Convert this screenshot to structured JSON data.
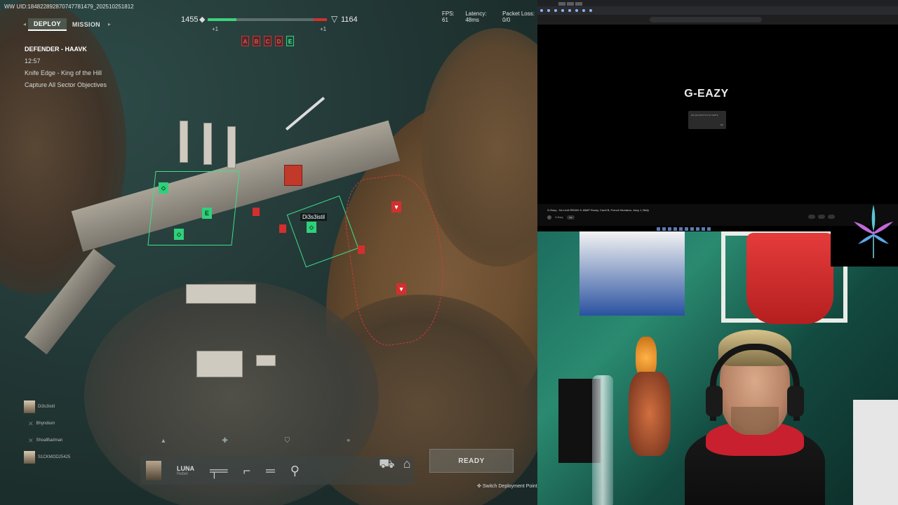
{
  "game": {
    "uid": "WW UID:184822892870747781479_202510251812",
    "tabs": [
      {
        "label": "DEPLOY",
        "active": true
      },
      {
        "label": "MISSION",
        "active": false
      }
    ],
    "mission": {
      "role": "DEFENDER - HAAVK",
      "timer": "12:57",
      "map_mode": "Knife Edge - King of the Hill",
      "objective": "Capture All Sector Objectives"
    },
    "score": {
      "friendly": "1455",
      "enemy": "1164",
      "friendly_plus": "+1",
      "enemy_plus": "+1",
      "friendly_progress": 0.24,
      "enemy_progress": 0.11
    },
    "objectives": [
      {
        "letter": "A",
        "team": "enemy"
      },
      {
        "letter": "B",
        "team": "enemy"
      },
      {
        "letter": "C",
        "team": "enemy"
      },
      {
        "letter": "D",
        "team": "enemy"
      },
      {
        "letter": "E",
        "team": "friendly"
      }
    ],
    "netstats": {
      "fps": "FPS: 61",
      "latency": "Latency: 48ms",
      "packet_loss": "Packet Loss: 0/0"
    },
    "map_labels": {
      "player_tag": "Di3s3istil",
      "marker_e": "E"
    },
    "squad": [
      {
        "name": "Di3s3istil"
      },
      {
        "name": "Bhyndium"
      },
      {
        "name": "ShoalBadman"
      },
      {
        "name": "S1CKMOD25425"
      }
    ],
    "loadout": {
      "operator_name": "LUNA",
      "operator_sub": "Rebel"
    },
    "ready_label": "READY",
    "switch_deploy": "Switch Deployment Point"
  },
  "browser": {
    "artist": "G-EAZY",
    "dialog_text": "Are you sure? Is it on now? ▸",
    "dialog_ok": "OK",
    "video_title": "G-Eazy - No Limit REMIX ft. A$AP Rocky, Cardi B, French Montana, Juicy J, Belly",
    "channel_name": "G-Eazy",
    "subscribe": "●●"
  },
  "colors": {
    "friendly": "#3fd07c",
    "enemy": "#d03030",
    "webcam_bg": "#1d6d5f"
  }
}
